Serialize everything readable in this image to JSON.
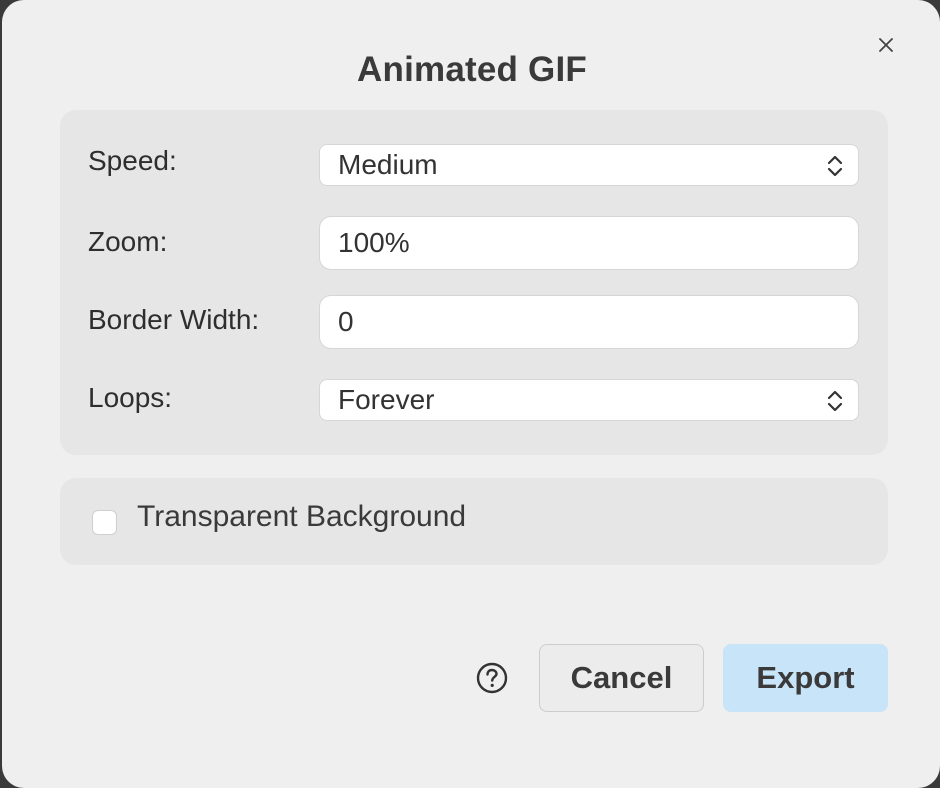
{
  "dialog": {
    "title": "Animated GIF",
    "close_icon": "close-icon"
  },
  "settings": {
    "speed": {
      "label": "Speed:",
      "value": "Medium"
    },
    "zoom": {
      "label": "Zoom:",
      "value": "100%"
    },
    "border_width": {
      "label": "Border Width:",
      "value": "0"
    },
    "loops": {
      "label": "Loops:",
      "value": "Forever"
    }
  },
  "options": {
    "transparent_background": {
      "label": "Transparent Background",
      "checked": false
    }
  },
  "footer": {
    "help_icon": "question-circle-icon",
    "cancel_label": "Cancel",
    "export_label": "Export"
  },
  "colors": {
    "dialog_bg": "#efefef",
    "panel_bg": "#e6e6e6",
    "export_bg": "#c8e4f8",
    "text": "#3a3a3a"
  }
}
